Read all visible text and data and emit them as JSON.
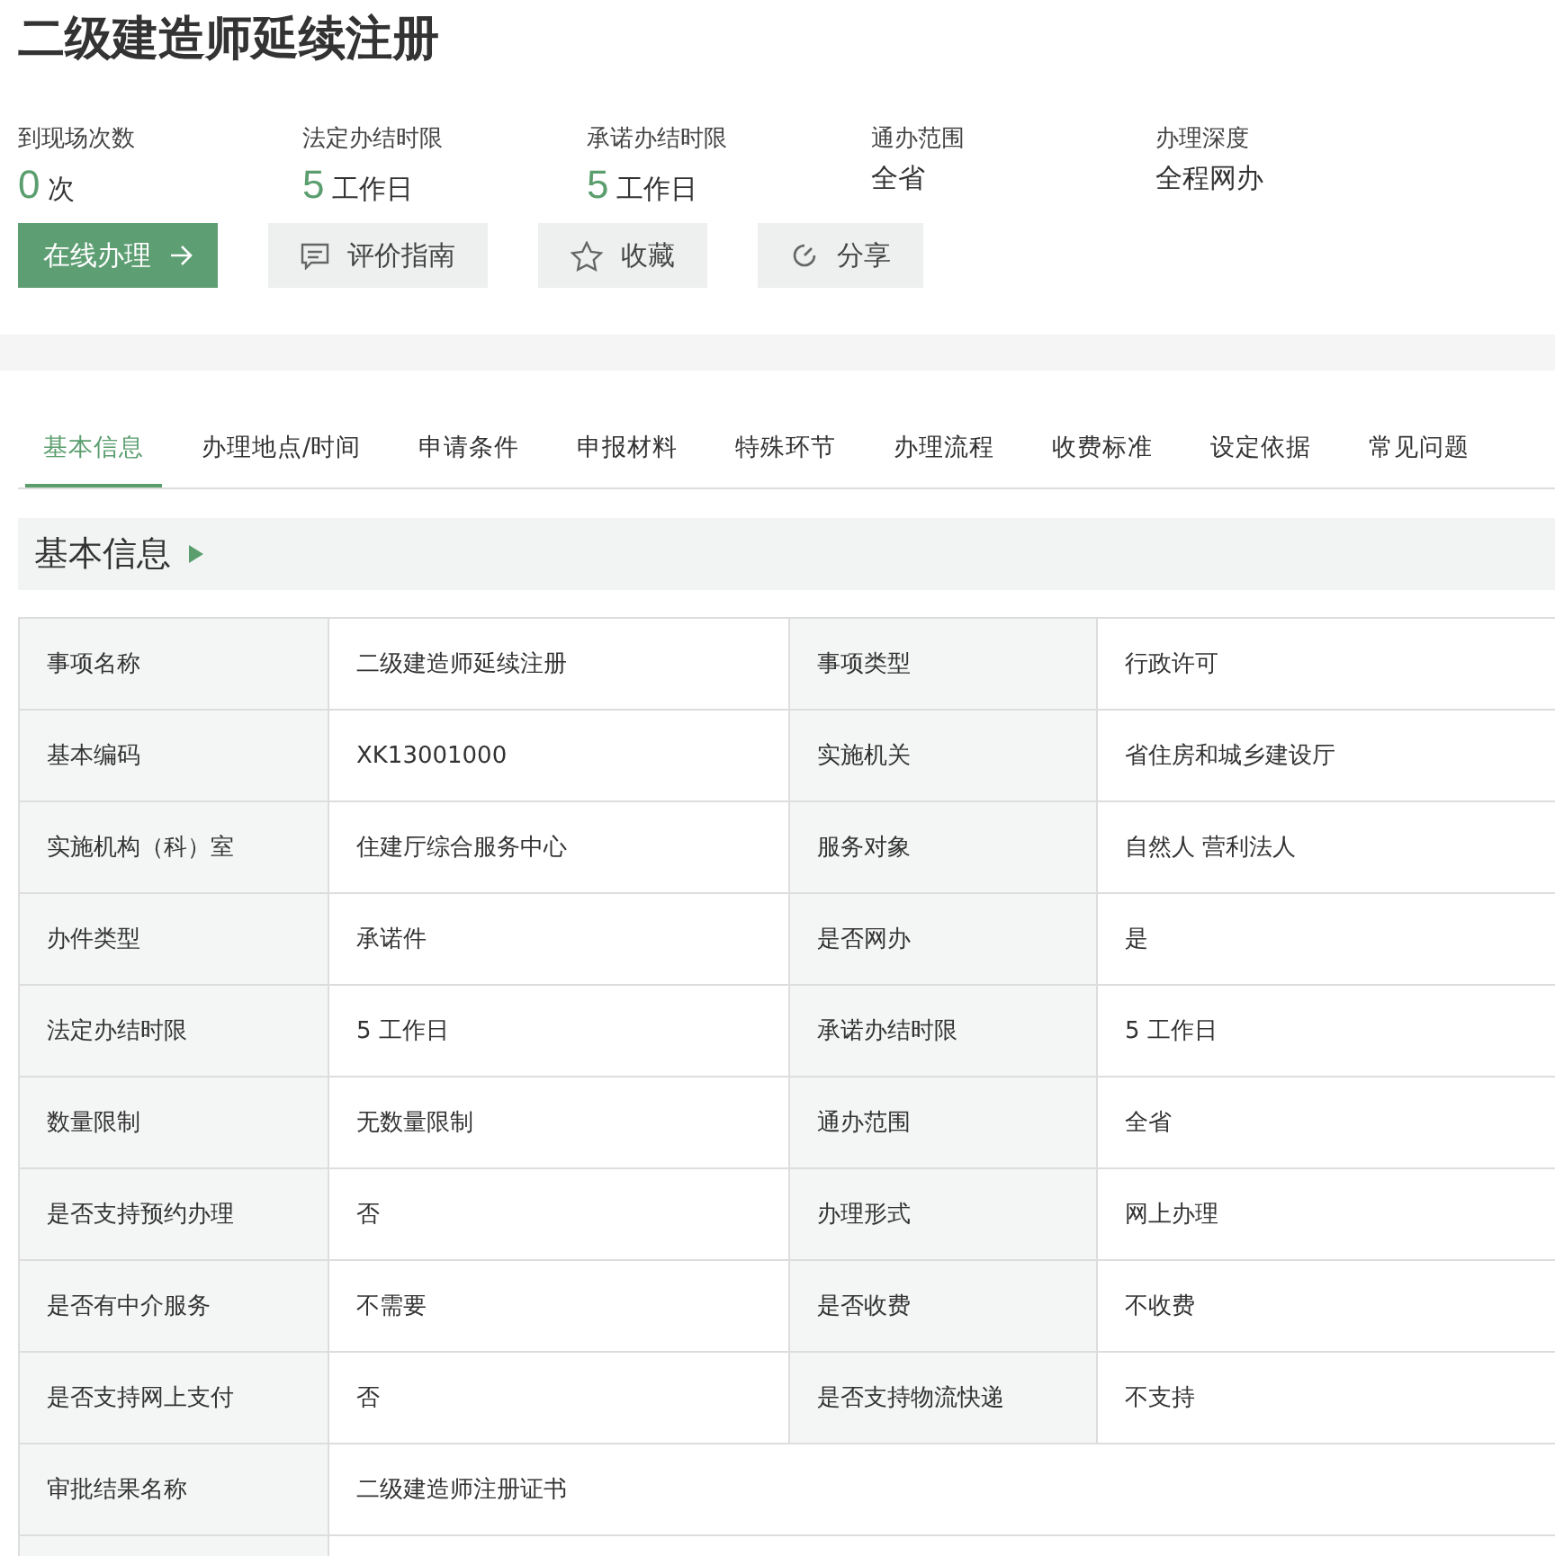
{
  "title": "二级建造师延续注册",
  "stats": [
    {
      "label": "到现场次数",
      "number": "0",
      "unit": "次"
    },
    {
      "label": "法定办结时限",
      "number": "5",
      "unit": "工作日"
    },
    {
      "label": "承诺办结时限",
      "number": "5",
      "unit": "工作日"
    },
    {
      "label": "通办范围",
      "value": "全省"
    },
    {
      "label": "办理深度",
      "value": "全程网办"
    }
  ],
  "actions": [
    {
      "kind": "primary",
      "label": "在线办理"
    },
    {
      "kind": "comment",
      "label": "评价指南"
    },
    {
      "kind": "star",
      "label": "收藏"
    },
    {
      "kind": "share",
      "label": "分享"
    }
  ],
  "tabs": [
    {
      "label": "基本信息",
      "selected": true
    },
    {
      "label": "办理地点/时间",
      "selected": false
    },
    {
      "label": "申请条件",
      "selected": false
    },
    {
      "label": "申报材料",
      "selected": false
    },
    {
      "label": "特殊环节",
      "selected": false
    },
    {
      "label": "办理流程",
      "selected": false
    },
    {
      "label": "收费标准",
      "selected": false
    },
    {
      "label": "设定依据",
      "selected": false
    },
    {
      "label": "常见问题",
      "selected": false
    }
  ],
  "section_title": "基本信息",
  "rows": [
    [
      "事项名称",
      "二级建造师延续注册",
      "事项类型",
      "行政许可"
    ],
    [
      "基本编码",
      "XK13001000",
      "实施机关",
      "省住房和城乡建设厅"
    ],
    [
      "实施机构（科）室",
      "住建厅综合服务中心",
      "服务对象",
      "自然人 营利法人"
    ],
    [
      "办件类型",
      "承诺件",
      "是否网办",
      "是"
    ],
    [
      "法定办结时限",
      "5 工作日",
      "承诺办结时限",
      "5 工作日"
    ],
    [
      "数量限制",
      "无数量限制",
      "通办范围",
      "全省"
    ],
    [
      "是否支持预约办理",
      "否",
      "办理形式",
      "网上办理"
    ],
    [
      "是否有中介服务",
      "不需要",
      "是否收费",
      "不收费"
    ],
    [
      "是否支持网上支付",
      "否",
      "是否支持物流快递",
      "不支持"
    ],
    [
      "审批结果名称",
      "二级建造师注册证书"
    ]
  ]
}
